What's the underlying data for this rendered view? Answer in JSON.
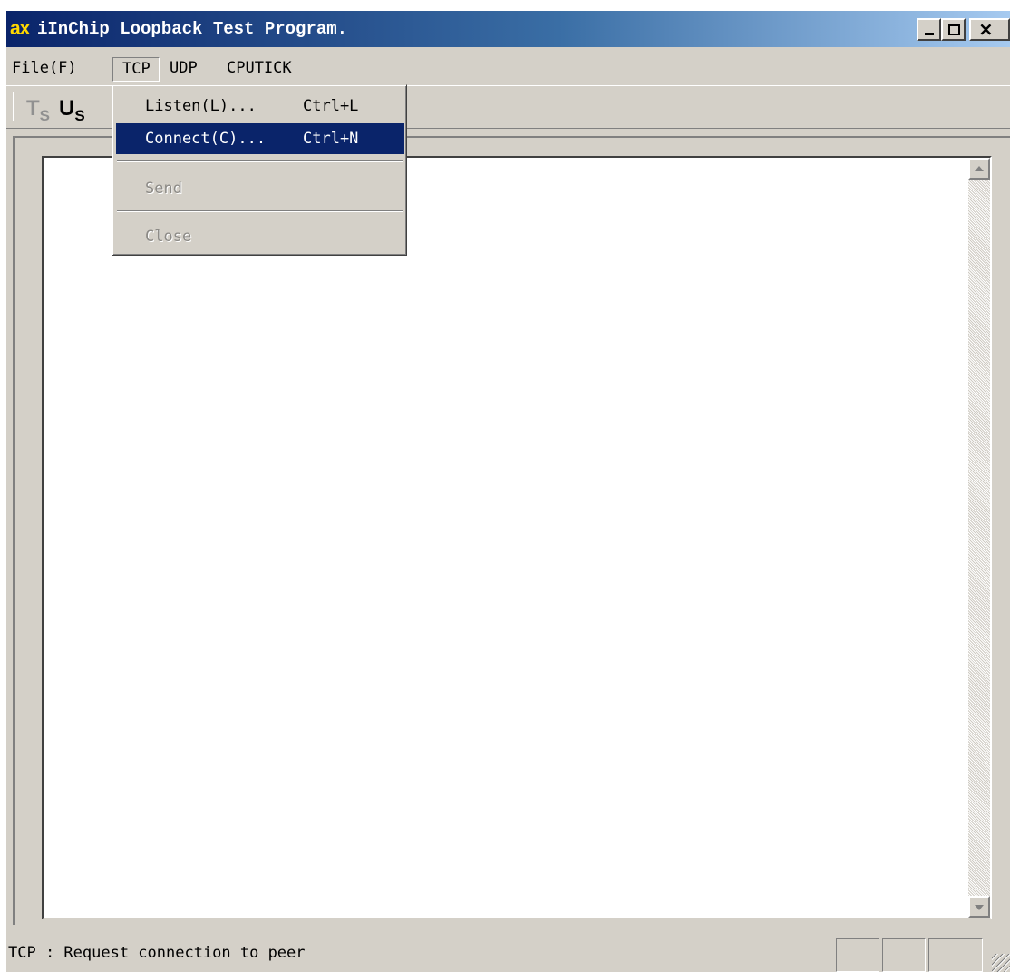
{
  "window": {
    "icon_text": "ax",
    "title": "iInChip Loopback Test Program.",
    "close_glyph": "×"
  },
  "menubar": {
    "items": [
      {
        "label": "File(F)"
      },
      {
        "label": "TCP"
      },
      {
        "label": "UDP"
      },
      {
        "label": "CPUTICK"
      }
    ]
  },
  "toolbar": {
    "buttons": [
      {
        "main": "T",
        "sub": "S",
        "icon": "tcp-send-icon",
        "enabled": false
      },
      {
        "main": "U",
        "sub": "S",
        "icon": "udp-send-icon",
        "enabled": true
      }
    ]
  },
  "tcp_menu": {
    "items": [
      {
        "label": "Listen(L)...",
        "shortcut": "Ctrl+L",
        "enabled": true
      },
      {
        "label": "Connect(C)...",
        "shortcut": "Ctrl+N",
        "enabled": true,
        "highlighted": true
      },
      {
        "label": "Send",
        "enabled": false
      },
      {
        "label": "Close",
        "enabled": false
      }
    ]
  },
  "statusbar": {
    "text": "TCP : Request connection to peer"
  },
  "colors": {
    "title_gradient_start": "#0a246a",
    "title_gradient_end": "#a6caf0",
    "menu_highlight": "#0a246a",
    "face": "#d4d0c8",
    "icon_accent": "#ffd800"
  }
}
